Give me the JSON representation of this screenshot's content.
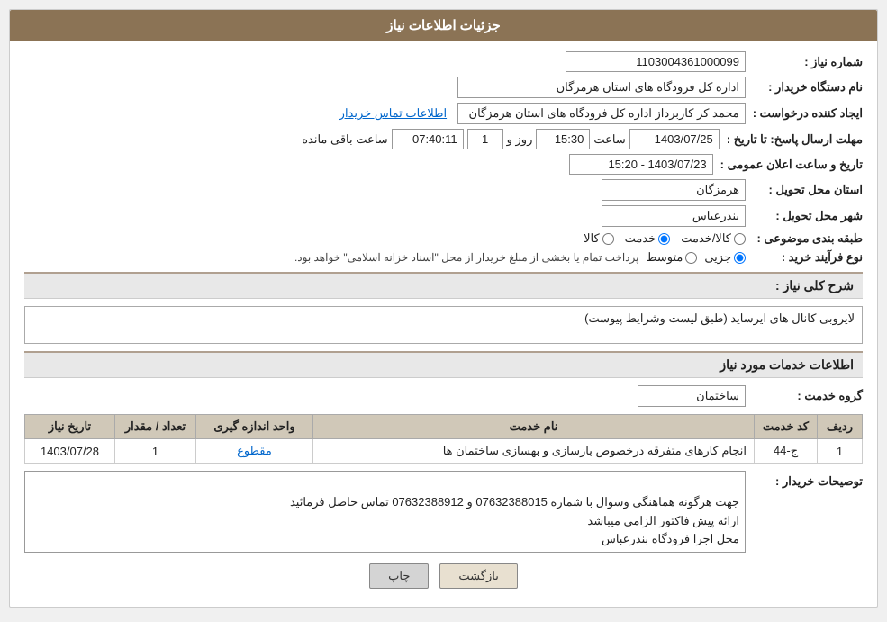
{
  "page": {
    "title": "جزئیات اطلاعات نیاز"
  },
  "header": {
    "shomara_niaz_label": "شماره نیاز :",
    "shomara_niaz_value": "1103004361000099",
    "nam_dastgah_label": "نام دستگاه خریدار :",
    "nam_dastgah_value": "اداره کل فرودگاه های استان هرمزگان",
    "ijad_konande_label": "ایجاد کننده درخواست :",
    "ijad_konande_value": "محمد کر کاربرداز اداره کل فرودگاه های استان هرمزگان",
    "ijad_konande_link": "اطلاعات تماس خریدار",
    "mohlat_label": "مهلت ارسال پاسخ: تا تاریخ :",
    "mohlat_date": "1403/07/25",
    "mohlat_saat_label": "ساعت",
    "mohlat_saat_value": "15:30",
    "mohlat_roz_label": "روز و",
    "mohlat_roz_value": "1",
    "mohlat_baqi_label": "ساعت باقی مانده",
    "mohlat_baqi_value": "07:40:11",
    "tarikh_label": "تاریخ و ساعت اعلان عمومی :",
    "tarikh_value": "1403/07/23 - 15:20",
    "ostan_label": "استان محل تحویل :",
    "ostan_value": "هرمزگان",
    "shahr_label": "شهر محل تحویل :",
    "shahr_value": "بندرعباس",
    "tabaqe_label": "طبقه بندی موضوعی :",
    "tabaqe_kala": "کالا",
    "tabaqe_khadamat": "خدمت",
    "tabaqe_kala_khadamat": "کالا/خدمت",
    "tabaqe_selected": "khadamat",
    "noue_farayand_label": "نوع فرآیند خرید :",
    "noue_jozii": "جزیی",
    "noue_motovaset": "متوسط",
    "noue_payam": "پرداخت تمام یا بخشی از مبلغ خریدار از محل \"اسناد خزانه اسلامی\" خواهد بود.",
    "noue_selected": "jozii"
  },
  "sharh": {
    "label": "شرح کلی نیاز :",
    "value": "لایروبی کانال های ایرساید (طبق لیست وشرایط پیوست)"
  },
  "khadamat": {
    "section_title": "اطلاعات خدمات مورد نیاز",
    "gorohe_label": "گروه خدمت :",
    "gorohe_value": "ساختمان",
    "table": {
      "headers": [
        "ردیف",
        "کد خدمت",
        "نام خدمت",
        "واحد اندازه گیری",
        "تعداد / مقدار",
        "تاریخ نیاز"
      ],
      "rows": [
        {
          "radif": "1",
          "kod": "ج-44",
          "nam": "انجام کارهای متفرقه درخصوص بازسازی و بهسازی ساختمان ها",
          "vahed": "مقطوع",
          "tedad": "1",
          "tarikh": "1403/07/28"
        }
      ]
    }
  },
  "tousif": {
    "label": "توصیحات خریدار :",
    "value": "جهت هرگونه هماهنگی وسوال با شماره 07632388015 و 07632388912 تماس حاصل فرمائید\nارائه پیش فاکتور الزامی میباشد\nمحل اجرا فرودگاه بندرعباس"
  },
  "buttons": {
    "back_label": "بازگشت",
    "print_label": "چاپ"
  }
}
